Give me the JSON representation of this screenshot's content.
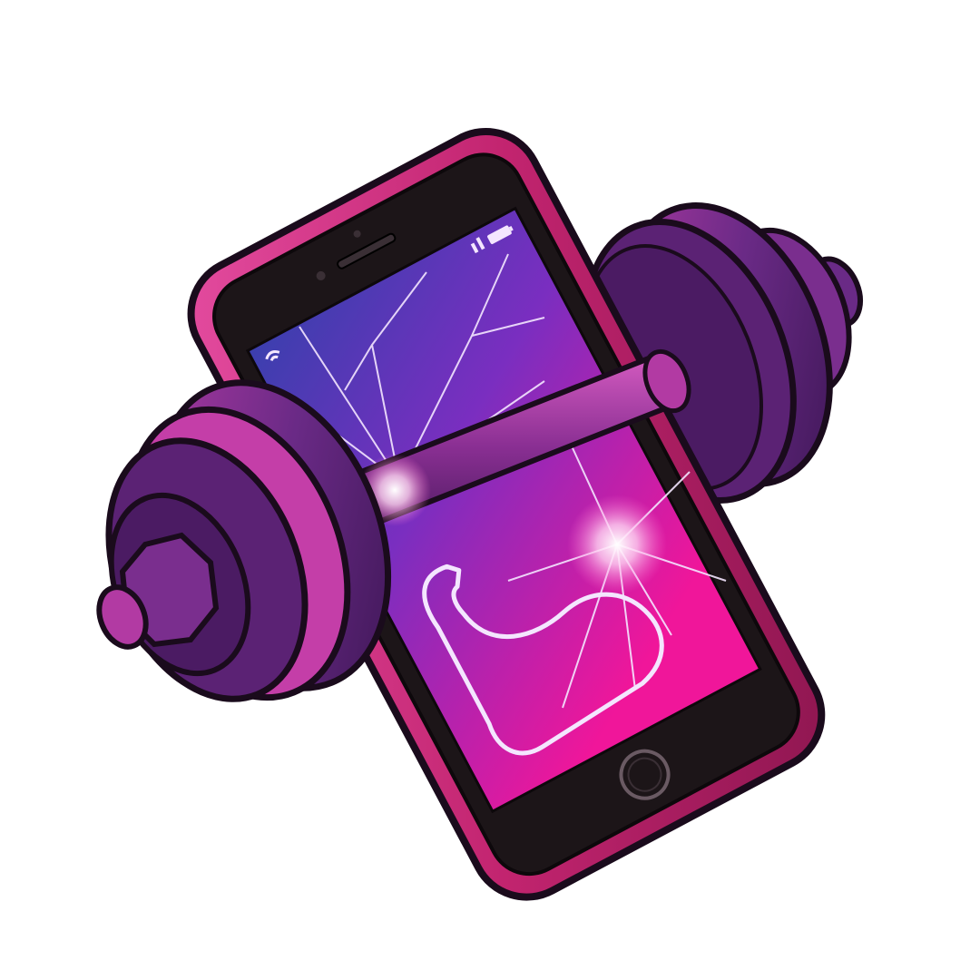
{
  "illustration": {
    "subject": [
      "dumbbell",
      "smartphone"
    ],
    "icons": [
      "flexed-biceps-icon",
      "signal-icon",
      "battery-icon",
      "home-button-icon",
      "screen-crack-icon"
    ]
  },
  "palette": {
    "background": "#ffffff",
    "outline": "#1a0b1c",
    "phone_body": "#c2246f",
    "phone_body_highlight": "#e44ca0",
    "phone_bezel": "#1c1518",
    "screen_top": "#3b3fae",
    "screen_mid": "#7a2ec0",
    "screen_bottom": "#f0169a",
    "weight_dark": "#3a1552",
    "weight_mid": "#6a2a86",
    "weight_light": "#b23aa3",
    "crack_line": "#f4e6ff"
  }
}
